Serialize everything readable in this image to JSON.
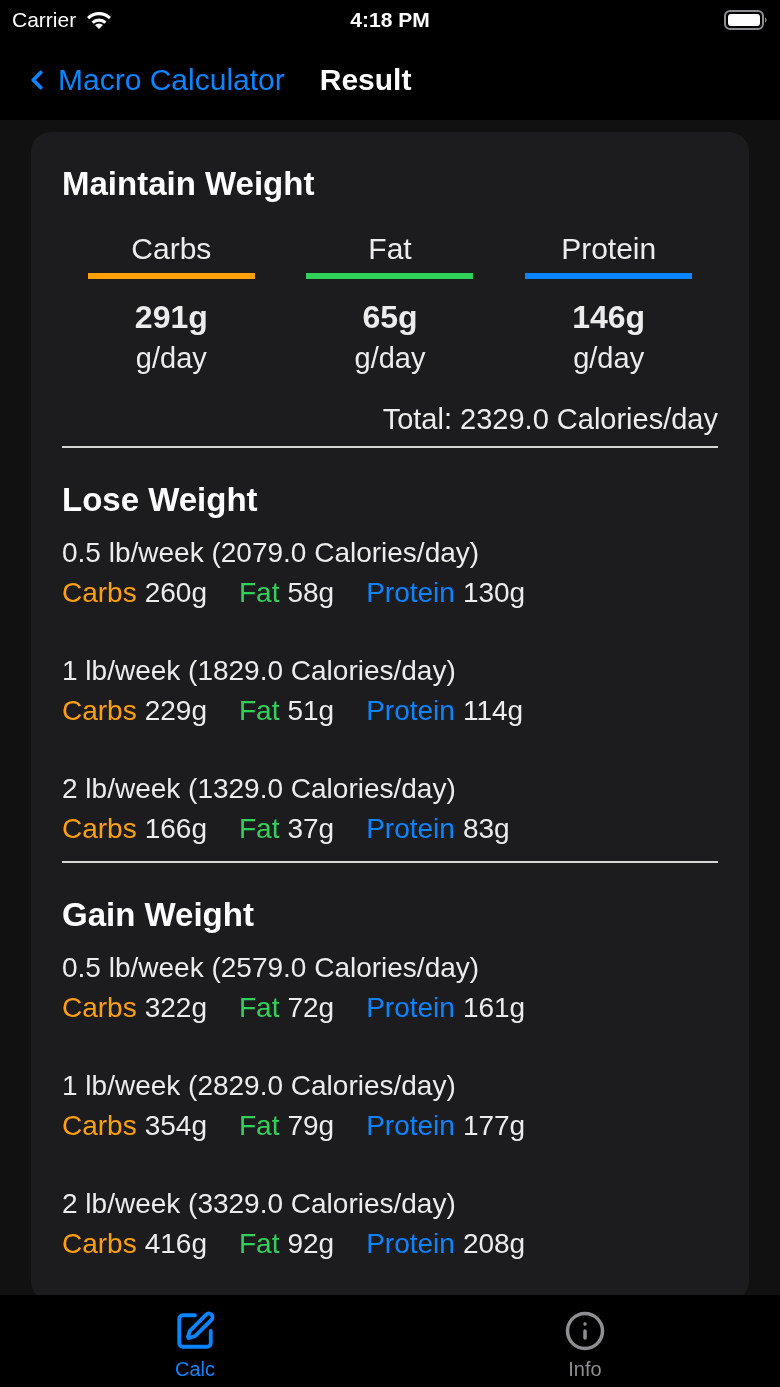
{
  "status_bar": {
    "carrier": "Carrier",
    "time": "4:18 PM"
  },
  "nav_bar": {
    "back_label": "Macro Calculator",
    "title": "Result"
  },
  "maintain": {
    "title": "Maintain Weight",
    "macros": [
      {
        "name": "Carbs",
        "color": "#ff9f0a",
        "amount": "291g",
        "unit": "g/day"
      },
      {
        "name": "Fat",
        "color": "#30d158",
        "amount": "65g",
        "unit": "g/day"
      },
      {
        "name": "Protein",
        "color": "#0a84ff",
        "amount": "146g",
        "unit": "g/day"
      }
    ],
    "total": "Total: 2329.0 Calories/day"
  },
  "plans": [
    {
      "title": "Lose Weight",
      "options": [
        {
          "rate": "0.5 lb/week (2079.0 Calories/day)",
          "macros": [
            {
              "name": "Carbs",
              "color": "#ff9f0a",
              "amount": "260g"
            },
            {
              "name": "Fat",
              "color": "#30d158",
              "amount": "58g"
            },
            {
              "name": "Protein",
              "color": "#0a84ff",
              "amount": "130g"
            }
          ]
        },
        {
          "rate": "1 lb/week (1829.0 Calories/day)",
          "macros": [
            {
              "name": "Carbs",
              "color": "#ff9f0a",
              "amount": "229g"
            },
            {
              "name": "Fat",
              "color": "#30d158",
              "amount": "51g"
            },
            {
              "name": "Protein",
              "color": "#0a84ff",
              "amount": "114g"
            }
          ]
        },
        {
          "rate": "2 lb/week (1329.0 Calories/day)",
          "macros": [
            {
              "name": "Carbs",
              "color": "#ff9f0a",
              "amount": "166g"
            },
            {
              "name": "Fat",
              "color": "#30d158",
              "amount": "37g"
            },
            {
              "name": "Protein",
              "color": "#0a84ff",
              "amount": "83g"
            }
          ]
        }
      ]
    },
    {
      "title": "Gain Weight",
      "options": [
        {
          "rate": "0.5 lb/week (2579.0 Calories/day)",
          "macros": [
            {
              "name": "Carbs",
              "color": "#ff9f0a",
              "amount": "322g"
            },
            {
              "name": "Fat",
              "color": "#30d158",
              "amount": "72g"
            },
            {
              "name": "Protein",
              "color": "#0a84ff",
              "amount": "161g"
            }
          ]
        },
        {
          "rate": "1 lb/week (2829.0 Calories/day)",
          "macros": [
            {
              "name": "Carbs",
              "color": "#ff9f0a",
              "amount": "354g"
            },
            {
              "name": "Fat",
              "color": "#30d158",
              "amount": "79g"
            },
            {
              "name": "Protein",
              "color": "#0a84ff",
              "amount": "177g"
            }
          ]
        },
        {
          "rate": "2 lb/week (3329.0 Calories/day)",
          "macros": [
            {
              "name": "Carbs",
              "color": "#ff9f0a",
              "amount": "416g"
            },
            {
              "name": "Fat",
              "color": "#30d158",
              "amount": "92g"
            },
            {
              "name": "Protein",
              "color": "#0a84ff",
              "amount": "208g"
            }
          ]
        }
      ]
    }
  ],
  "tab_bar": [
    {
      "label": "Calc",
      "selected": true
    },
    {
      "label": "Info",
      "selected": false
    }
  ]
}
